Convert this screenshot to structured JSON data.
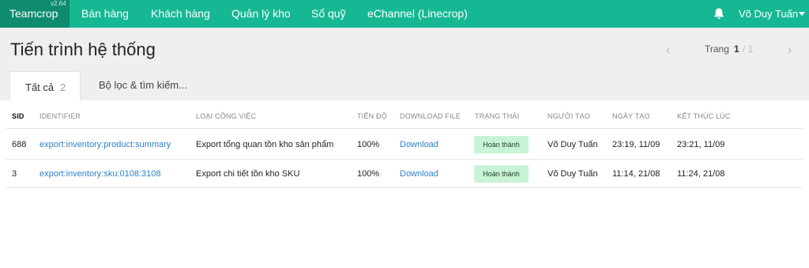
{
  "nav": {
    "brand": "Teamcrop",
    "version": "v2.64",
    "items": [
      {
        "label": "Bán hàng"
      },
      {
        "label": "Khách hàng"
      },
      {
        "label": "Quản lý kho"
      },
      {
        "label": "Sổ quỹ"
      },
      {
        "label": "eChannel (Linecrop)"
      }
    ],
    "user_name": "Võ Duy Tuấn",
    "icons": {
      "notification": "bell-icon",
      "user_menu": "caret-down-icon"
    }
  },
  "page": {
    "title": "Tiến trình hệ thống",
    "pager": {
      "label": "Trang",
      "current": "1",
      "separator": "/ 1",
      "prev_icon": "chevron-left-icon",
      "next_icon": "chevron-right-icon"
    },
    "tabs": {
      "all_label": "Tất cả",
      "all_count": "2",
      "filter_label": "Bộ lọc & tìm kiếm..."
    }
  },
  "table": {
    "headers": {
      "sid": "SID",
      "identifier": "IDENTIFIER",
      "job_type": "LOẠI CÔNG VIỆC",
      "progress": "TIẾN ĐỘ",
      "download": "DOWNLOAD FILE",
      "status": "TRẠNG THÁI",
      "creator": "NGƯỜI TẠO",
      "created": "NGÀY TẠO",
      "finished": "KẾT THÚC LÚC"
    },
    "rows": [
      {
        "sid": "688",
        "identifier": "export:inventory:product:summary",
        "job_type": "Export tổng quan tồn kho sản phẩm",
        "progress": "100%",
        "download": "Download",
        "status": "Hoàn thành",
        "creator": "Võ Duy Tuấn",
        "created": "23:19, 11/09",
        "finished": "23:21, 11/09"
      },
      {
        "sid": "3",
        "identifier": "export:inventory:sku:0108:3108",
        "job_type": "Export chi tiết tồn kho SKU",
        "progress": "100%",
        "download": "Download",
        "status": "Hoàn thành",
        "creator": "Võ Duy Tuấn",
        "created": "11:14, 21/08",
        "finished": "11:24, 21/08"
      }
    ]
  },
  "colors": {
    "nav_bg": "#16b894",
    "brand_bg": "#0f8b70",
    "link": "#2f80c9",
    "status_badge_bg": "#c9f3d6"
  }
}
